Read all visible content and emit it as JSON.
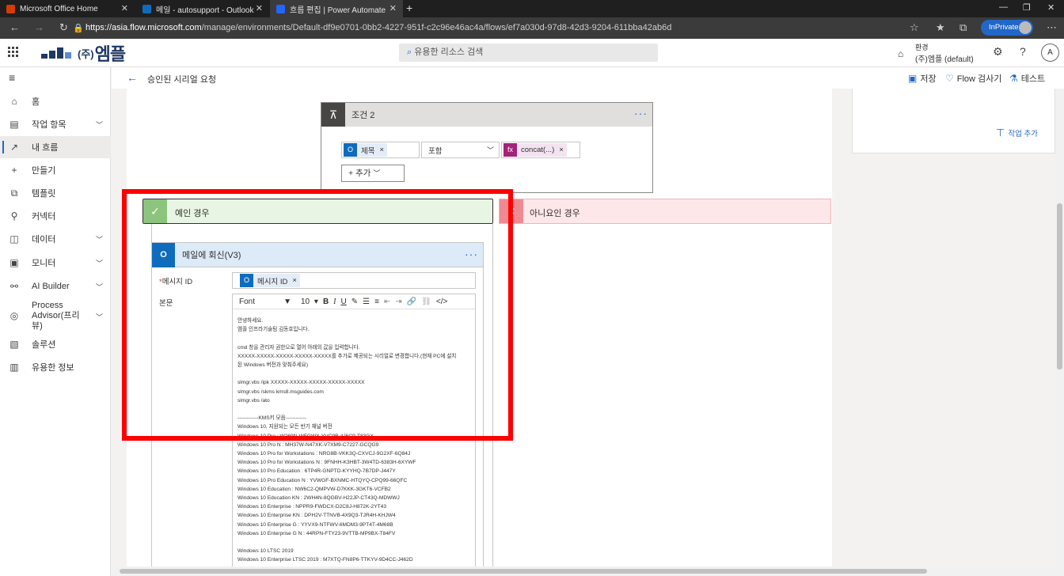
{
  "browser": {
    "tabs": [
      {
        "title": "Microsoft Office Home",
        "icon": "office-icon",
        "color": "#d83b01"
      },
      {
        "title": "메일 - autosupport - Outlook",
        "icon": "outlook-icon",
        "color": "#0f6cbd"
      },
      {
        "title": "흐름 편집 | Power Automate",
        "icon": "power-automate-icon",
        "color": "#2266ff"
      }
    ],
    "new_tab": "+",
    "url_host": "https://asia.flow.microsoft.com",
    "url_path": "/manage/environments/Default-df9e0701-0bb2-4227-951f-c2c96e46ac4a/flows/ef7a030d-97d8-42d3-9204-611bba42ab6d",
    "inprivate": "InPrivate"
  },
  "header": {
    "logo_paren": "(주)",
    "logo_text": "엠플",
    "search_placeholder": "유용한 리소스 검색",
    "env_label": "환경",
    "env_value": "(주)엠플 (default)",
    "account_initial": "A"
  },
  "commandbar": {
    "flow_title": "승인된 시리얼 요청",
    "save": "저장",
    "checker": "Flow 검사기",
    "test": "테스트"
  },
  "sidebar": {
    "items": [
      {
        "label": "홈",
        "icon": "home-icon"
      },
      {
        "label": "작업 항목",
        "icon": "clipboard-icon"
      },
      {
        "label": "내 흐름",
        "icon": "flow-icon"
      },
      {
        "label": "만들기",
        "icon": "plus-icon"
      },
      {
        "label": "템플릿",
        "icon": "template-icon"
      },
      {
        "label": "커넥터",
        "icon": "connector-icon"
      },
      {
        "label": "데이터",
        "icon": "database-icon"
      },
      {
        "label": "모니터",
        "icon": "monitor-icon"
      },
      {
        "label": "AI Builder",
        "icon": "ai-icon"
      },
      {
        "label": "Process Advisor(프리뷰)",
        "icon": "process-icon"
      },
      {
        "label": "솔루션",
        "icon": "solution-icon"
      },
      {
        "label": "유용한 정보",
        "icon": "book-icon"
      }
    ]
  },
  "right_panel": {
    "add_action": "작업 추가"
  },
  "condition": {
    "title": "조건 2",
    "left_token": "제목",
    "operator": "포함",
    "right_token": "concat(...)",
    "add": "추가"
  },
  "branches": {
    "yes": "예인 경우",
    "no": "아니요인 경우"
  },
  "reply": {
    "title": "메일에 회신(V3)",
    "message_id_label": "메시지 ID",
    "message_id_token": "메시지 ID",
    "body_label": "본문",
    "font": "Font",
    "font_size": "10",
    "body_text": "안녕하세요.\n엠플 인프라기술팀 김동호입니다.\n\ncmd 창을 관리자 권한으로 열어 아래의 값을 입력합니다.\nXXXXX-XXXXX-XXXXX-XXXXX-XXXXX를 추가로 제공되는 시리얼로 변경합니다.(현재 PC에 설치\n된 Windows 버전과 맞춰주세요)\n\nslmgr.vbs /ipk XXXXX-XXXXX-XXXXX-XXXXX-XXXXX\nslmgr.vbs /skms kms8.msguides.com\nslmgr.vbs /ato\n\n------------KMS키 모음------------\nWindows 10, 지원되는 모든 반기 채널 버전\nWindows 10 Pro : W269N-WFGWX-YVC9B-4J6C9-T83GX\nWindows 10 Pro N : MH37W-N47XK-V7XM9-C7227-GCQG9\nWindows 10 Pro for Workstations : NRG8B-VKK3Q-CXVCJ-9G2XF-6Q84J\nWindows 10 Pro for Workstations N : 9FNHH-K3HBT-3W4TD-6383H-6XYWF\nWindows 10 Pro Education : 6TP4R-GNPTD-KYYHQ-7B7DP-J447Y\nWindows 10 Pro Education N : YVWGF-BXNMC-HTQYQ-CPQ99-66QFC\nWindows 10 Education : NW6C2-QMPVW-D7KKK-3GKT6-VCFB2\nWindows 10 Education KN : 2WH4N-8QGBV-H22JP-CT43Q-MDWWJ\nWindows 10 Enterprise : NPPR9-FWDCX-D2C8J-H872K-2YT43\nWindows 10 Enterprise KN : DPH2V-TTNVB-4X9Q3-TJR4H-KHJW4\nWindows 10 Enterprise G : YYVX9-NTFWV-6MDM3-9PT4T-4M68B\nWindows 10 Enterprise G N : 44RPN-FTY23-9VTTB-MP9BX-T84FV\n\nWindows 10 LTSC 2019\nWindows 10 Enterprise LTSC 2019 : M7XTQ-FN8P6-TTKYV-9D4CC-J462D"
  }
}
